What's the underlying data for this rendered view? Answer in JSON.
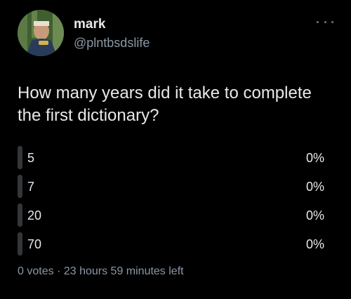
{
  "user": {
    "display_name": "mark",
    "handle": "@plntbsdslife"
  },
  "question": "How many years did it take to complete the first dictionary?",
  "poll": {
    "options": [
      {
        "label": "5",
        "percent_text": "0%",
        "percent": 0
      },
      {
        "label": "7",
        "percent_text": "0%",
        "percent": 0
      },
      {
        "label": "20",
        "percent_text": "0%",
        "percent": 0
      },
      {
        "label": "70",
        "percent_text": "0%",
        "percent": 0
      }
    ],
    "votes": "0 votes",
    "separator": "·",
    "time_left": "23 hours 59 minutes left"
  },
  "icons": {
    "more": "more-horizontal-icon"
  },
  "colors": {
    "background": "#000000",
    "text": "#e7e9ea",
    "secondary_text": "#8b98a5",
    "bar_fill": "#333639"
  }
}
